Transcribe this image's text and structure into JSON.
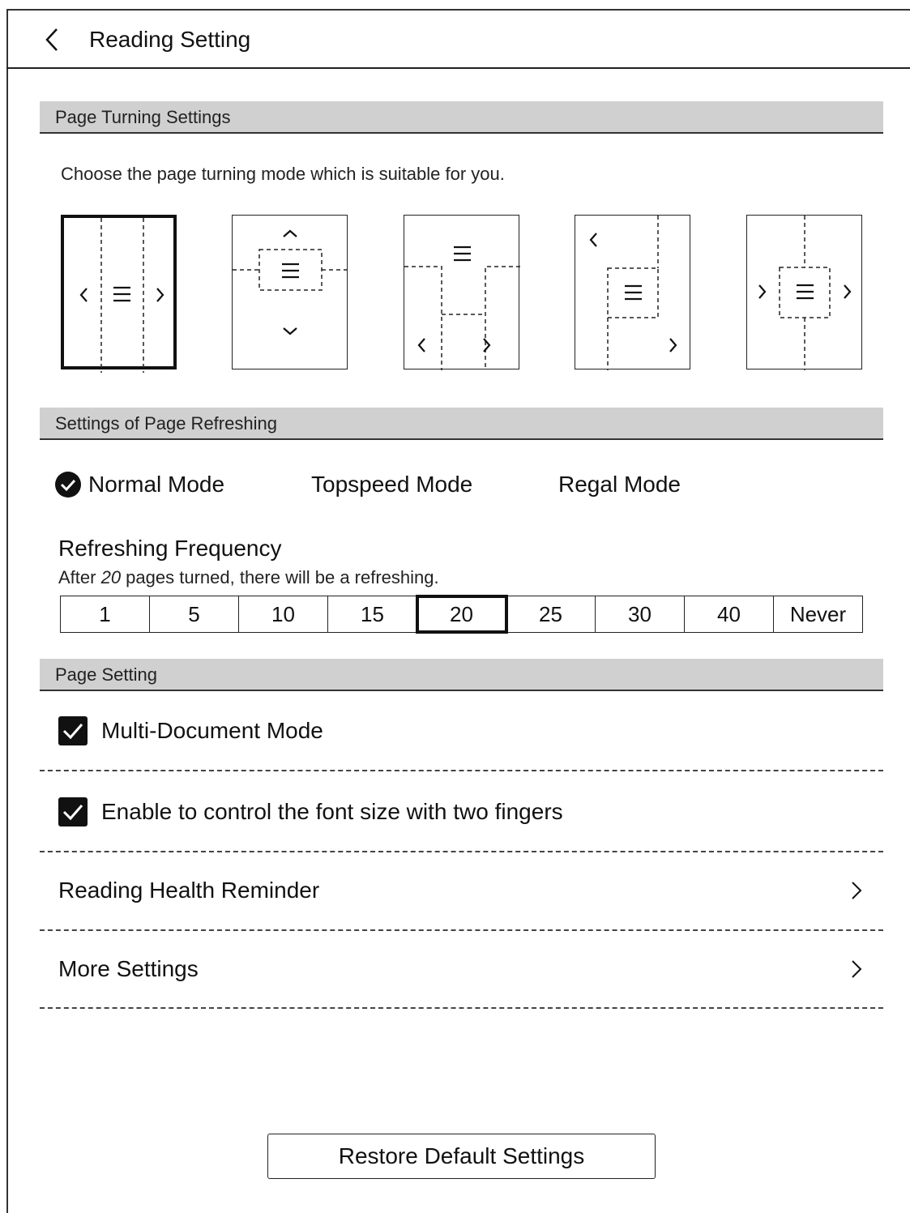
{
  "header": {
    "title": "Reading Setting"
  },
  "page_turning": {
    "section_title": "Page Turning Settings",
    "description": "Choose the page turning mode which is suitable for you.",
    "modes": [
      {
        "name": "left-right-columns",
        "selected": true
      },
      {
        "name": "top-bottom",
        "selected": false
      },
      {
        "name": "bottom-left-right",
        "selected": false
      },
      {
        "name": "diagonal-left-right",
        "selected": false
      },
      {
        "name": "both-forward",
        "selected": false
      }
    ]
  },
  "refreshing": {
    "section_title": "Settings of Page Refreshing",
    "modes": [
      {
        "label": "Normal Mode",
        "selected": true
      },
      {
        "label": "Topspeed Mode",
        "selected": false
      },
      {
        "label": "Regal Mode",
        "selected": false
      }
    ],
    "frequency_title": "Refreshing Frequency",
    "frequency_desc_prefix": "After ",
    "frequency_desc_value": "20",
    "frequency_desc_suffix": " pages turned, there will be a refreshing.",
    "frequency_options": [
      "1",
      "5",
      "10",
      "15",
      "20",
      "25",
      "30",
      "40",
      "Never"
    ],
    "frequency_selected": "20"
  },
  "page_setting": {
    "section_title": "Page Setting",
    "multi_document_label": "Multi-Document Mode",
    "multi_document_checked": true,
    "two_finger_label": "Enable to control the font size with two fingers",
    "two_finger_checked": true,
    "health_reminder_label": "Reading Health Reminder",
    "more_settings_label": "More Settings"
  },
  "restore_button": "Restore Default Settings",
  "colors": {
    "section_bg": "#d0d0d0",
    "ink": "#111111"
  }
}
